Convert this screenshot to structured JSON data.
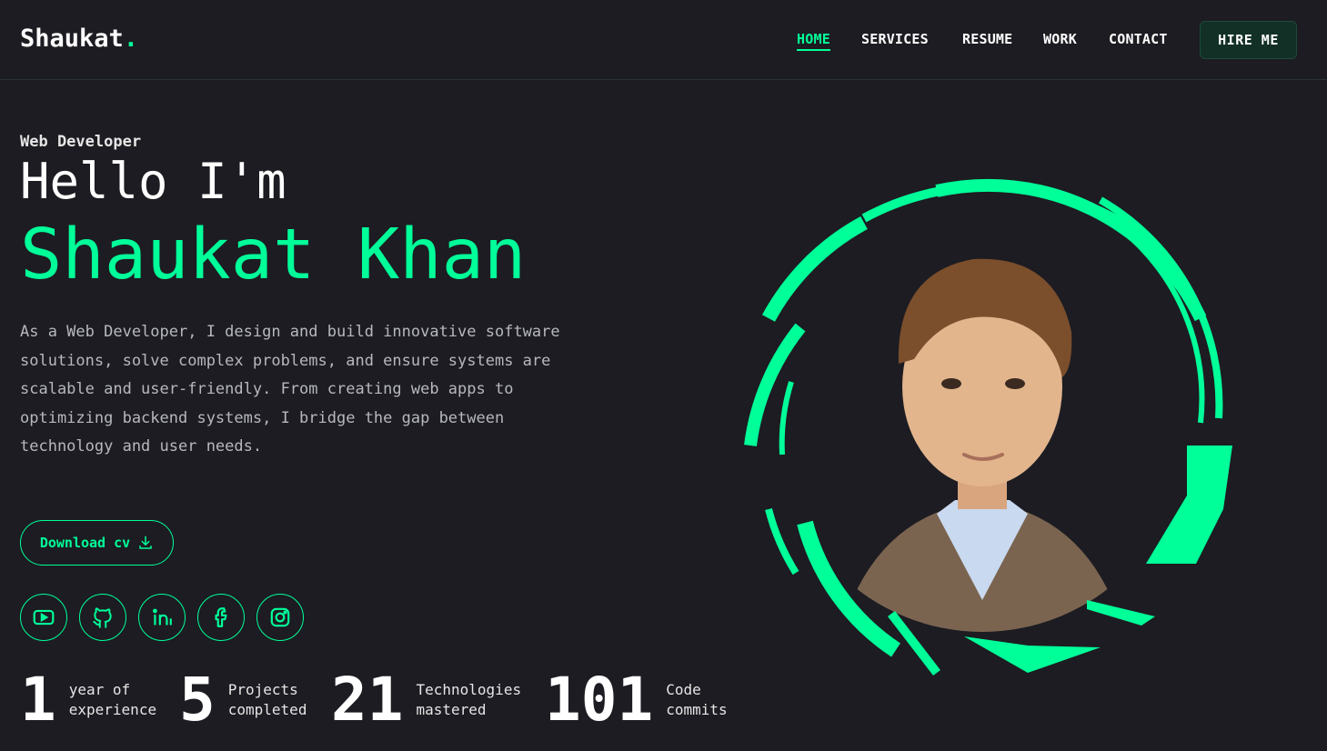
{
  "header": {
    "logo_text": "Shaukat",
    "logo_dot": ".",
    "nav": [
      {
        "label": "HOME",
        "active": true
      },
      {
        "label": "SERVICES",
        "active": false
      },
      {
        "label": "RESUME",
        "active": false
      },
      {
        "label": "WORK",
        "active": false
      },
      {
        "label": "CONTACT",
        "active": false
      }
    ],
    "hire_label": "HIRE ME"
  },
  "hero": {
    "role": "Web Developer",
    "greeting": "Hello I'm",
    "name": "Shaukat Khan",
    "description": "As a Web Developer, I design and build innovative software solutions, solve complex problems, and ensure systems are scalable and user-friendly. From creating web apps to optimizing backend systems, I bridge the gap between technology and user needs.",
    "download_label": "Download cv",
    "download_icon": "download-icon"
  },
  "socials": [
    {
      "name": "youtube-icon"
    },
    {
      "name": "github-icon"
    },
    {
      "name": "linkedin-icon"
    },
    {
      "name": "facebook-icon"
    },
    {
      "name": "instagram-icon"
    }
  ],
  "stats": [
    {
      "value": "1",
      "label_line1": "year of",
      "label_line2": "experience"
    },
    {
      "value": "5",
      "label_line1": "Projects",
      "label_line2": "completed"
    },
    {
      "value": "21",
      "label_line1": "Technologies",
      "label_line2": "mastered"
    },
    {
      "value": "101",
      "label_line1": "Code",
      "label_line2": "commits"
    }
  ],
  "colors": {
    "background": "#1c1c22",
    "accent": "#00ff99",
    "text": "#ffffff",
    "muted": "#b7b7bf"
  }
}
